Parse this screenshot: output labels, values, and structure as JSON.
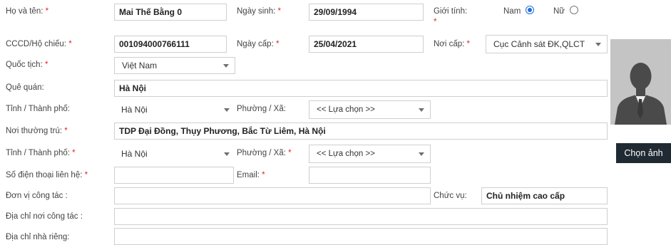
{
  "form": {
    "full_name": {
      "label": "Họ và tên:",
      "required_mark": "*",
      "value": "Mai Thế Bằng 0"
    },
    "birth_date": {
      "label": "Ngày sinh:",
      "required_mark": "*",
      "value": "29/09/1994"
    },
    "gender": {
      "label": "Giới tính:",
      "required_mark": "*",
      "options": [
        {
          "label": "Nam",
          "selected": true
        },
        {
          "label": "Nữ",
          "selected": false
        }
      ]
    },
    "id_number": {
      "label": "CCCD/Hộ chiếu:",
      "required_mark": "*",
      "value": "001094000766111"
    },
    "issue_date": {
      "label": "Ngày cấp:",
      "required_mark": "*",
      "value": "25/04/2021"
    },
    "issue_place": {
      "label": "Nơi cấp:",
      "required_mark": "*",
      "value": "Cục Cảnh sát ĐK,QLCT"
    },
    "nationality": {
      "label": "Quốc tịch:",
      "required_mark": "*",
      "value": "Việt Nam"
    },
    "hometown": {
      "label": "Quê quán:",
      "value": "Hà Nội"
    },
    "province_1": {
      "label": "Tỉnh / Thành phố:",
      "value": "Hà Nội"
    },
    "ward_1": {
      "label": "Phường / Xã:",
      "value": "<< Lựa chọn >>"
    },
    "permanent_address": {
      "label": "Nơi thường trú:",
      "required_mark": "*",
      "value": "TDP Đại Đồng, Thụy Phương, Bắc Từ Liêm, Hà Nội"
    },
    "province_2": {
      "label": "Tỉnh / Thành phố:",
      "required_mark": "*",
      "value": "Hà Nội"
    },
    "ward_2": {
      "label": "Phường / Xã:",
      "required_mark": "*",
      "value": "<< Lựa chọn >>"
    },
    "phone": {
      "label": "Số điện thoại liên hệ:",
      "required_mark": "*",
      "value": ""
    },
    "email": {
      "label": "Email:",
      "required_mark": "*",
      "value": ""
    },
    "work_unit": {
      "label": "Đơn vị công tác :",
      "value": ""
    },
    "position": {
      "label": "Chức vụ:",
      "value": "Chủ nhiệm cao cấp"
    },
    "work_address": {
      "label": "Địa chỉ nơi công tác :",
      "value": ""
    },
    "home_address": {
      "label": "Địa chỉ nhà riêng:",
      "value": ""
    }
  },
  "photo": {
    "choose_button_label": "Chọn ảnh",
    "icon": "person-silhouette-icon",
    "background_color": "#c4c4c4"
  },
  "colors": {
    "required": "#e0242f",
    "radio_selected": "#1e6fd9",
    "button_bg": "#1f2a33"
  }
}
